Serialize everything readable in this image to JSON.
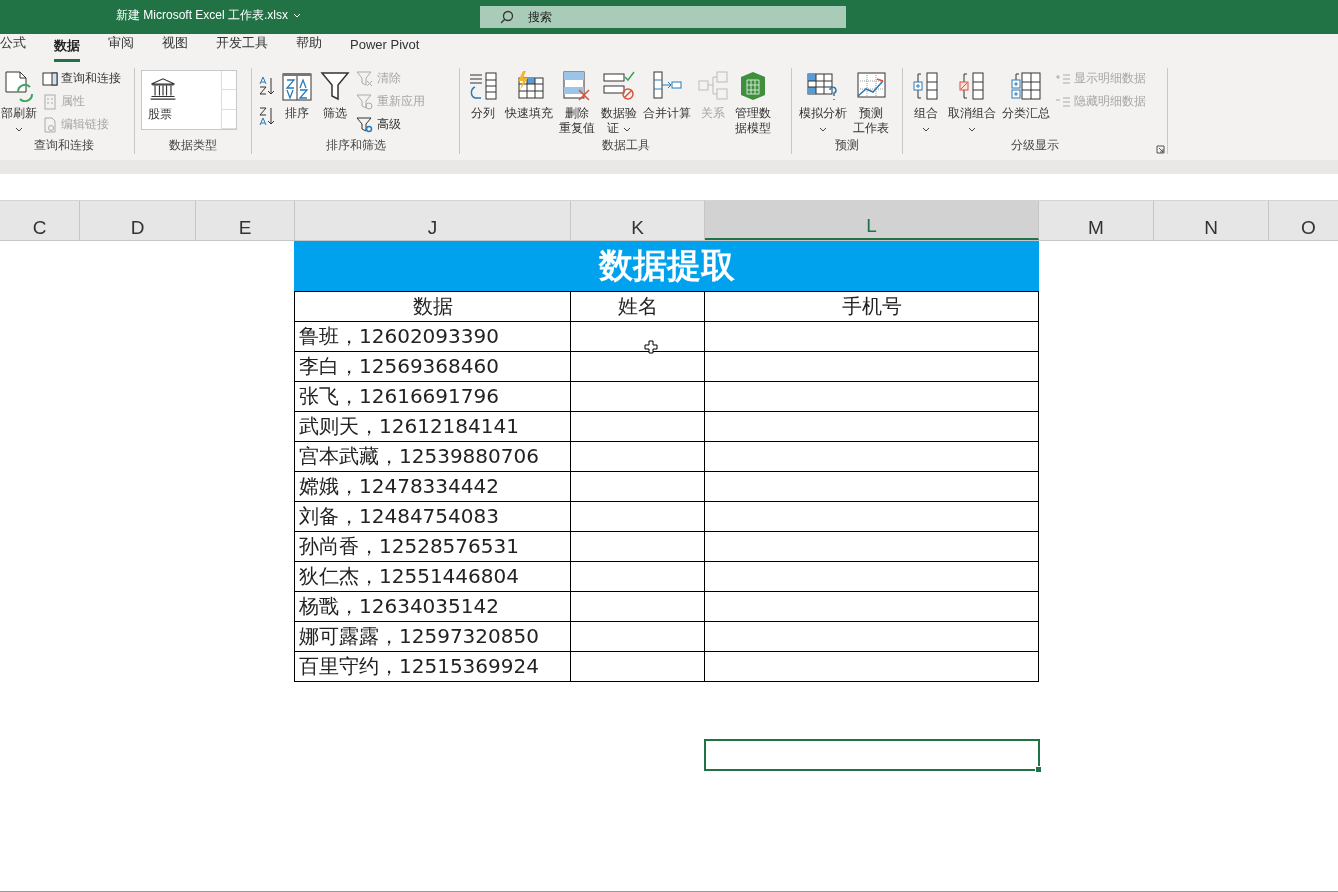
{
  "window": {
    "title": "新建 Microsoft Excel 工作表.xlsx",
    "title_dropdown": true
  },
  "search": {
    "placeholder": "搜索"
  },
  "menu_tabs": [
    {
      "label": "公式",
      "selected": false
    },
    {
      "label": "数据",
      "selected": true
    },
    {
      "label": "审阅",
      "selected": false
    },
    {
      "label": "视图",
      "selected": false
    },
    {
      "label": "开发工具",
      "selected": false
    },
    {
      "label": "帮助",
      "selected": false
    },
    {
      "label": "Power Pivot",
      "selected": false
    }
  ],
  "ribbon": {
    "groups": [
      {
        "label": "查询和连接",
        "items": [
          {
            "kind": "large",
            "lines": [
              "部刷新"
            ],
            "dropdown": true,
            "disabled": false
          },
          {
            "kind": "stack",
            "items": [
              {
                "label": "查询和连接",
                "disabled": false
              },
              {
                "label": "属性",
                "disabled": true
              },
              {
                "label": "编辑链接",
                "disabled": true
              }
            ]
          }
        ]
      },
      {
        "label": "数据类型",
        "items": [
          {
            "kind": "gallery",
            "lines": [
              "股票"
            ]
          }
        ]
      },
      {
        "label": "排序和筛选",
        "items": [
          {
            "kind": "sort-pair"
          },
          {
            "kind": "large",
            "lines": [
              "排序"
            ],
            "dropdown": false,
            "disabled": false
          },
          {
            "kind": "large",
            "lines": [
              "筛选"
            ],
            "dropdown": false,
            "disabled": false
          },
          {
            "kind": "stack",
            "items": [
              {
                "label": "清除",
                "disabled": true
              },
              {
                "label": "重新应用",
                "disabled": true
              },
              {
                "label": "高级",
                "disabled": false
              }
            ]
          }
        ]
      },
      {
        "label": "数据工具",
        "items": [
          {
            "kind": "large",
            "lines": [
              "分列"
            ],
            "dropdown": false,
            "disabled": false
          },
          {
            "kind": "large",
            "lines": [
              "快速填充"
            ],
            "dropdown": false,
            "disabled": false
          },
          {
            "kind": "large",
            "lines": [
              "删除",
              "重复值"
            ],
            "dropdown": false,
            "disabled": false
          },
          {
            "kind": "large",
            "lines": [
              "数据验",
              "证"
            ],
            "dropdown": true,
            "disabled": false
          },
          {
            "kind": "large",
            "lines": [
              "合并计算"
            ],
            "dropdown": false,
            "disabled": false
          },
          {
            "kind": "large",
            "lines": [
              "关系"
            ],
            "dropdown": false,
            "disabled": true
          },
          {
            "kind": "large",
            "lines": [
              "管理数",
              "据模型"
            ],
            "dropdown": false,
            "disabled": false
          }
        ]
      },
      {
        "label": "预测",
        "items": [
          {
            "kind": "large",
            "lines": [
              "模拟分析"
            ],
            "dropdown": true,
            "disabled": false
          },
          {
            "kind": "large",
            "lines": [
              "预测",
              "工作表"
            ],
            "dropdown": false,
            "disabled": false
          }
        ]
      },
      {
        "label": "分级显示",
        "launcher": true,
        "items": [
          {
            "kind": "large",
            "lines": [
              "组合"
            ],
            "dropdown": true,
            "disabled": false
          },
          {
            "kind": "large",
            "lines": [
              "取消组合"
            ],
            "dropdown": true,
            "disabled": false
          },
          {
            "kind": "large",
            "lines": [
              "分类汇总"
            ],
            "dropdown": false,
            "disabled": false
          },
          {
            "kind": "stack",
            "items": [
              {
                "label": "显示明细数据",
                "disabled": true
              },
              {
                "label": "隐藏明细数据",
                "disabled": true
              }
            ]
          }
        ]
      }
    ]
  },
  "column_headers": [
    {
      "label": "C",
      "selected": false
    },
    {
      "label": "D",
      "selected": false
    },
    {
      "label": "E",
      "selected": false
    },
    {
      "label": "J",
      "selected": false
    },
    {
      "label": "K",
      "selected": false
    },
    {
      "label": "L",
      "selected": true
    },
    {
      "label": "M",
      "selected": false
    },
    {
      "label": "N",
      "selected": false
    },
    {
      "label": "O",
      "selected": false
    }
  ],
  "sheet": {
    "title": "数据提取",
    "columns": [
      "数据",
      "姓名",
      "手机号"
    ],
    "rows": [
      "鲁班，12602093390",
      "李白，12569368460",
      "张飞，12616691796",
      "武则天，12612184141",
      "宫本武藏，12539880706",
      "嫦娥，12478334442",
      "刘备，12484754083",
      "孙尚香，12528576531",
      "狄仁杰，12551446804",
      "杨戬，12634035142",
      "娜可露露，12597320850",
      "百里守约，12515369924"
    ]
  }
}
